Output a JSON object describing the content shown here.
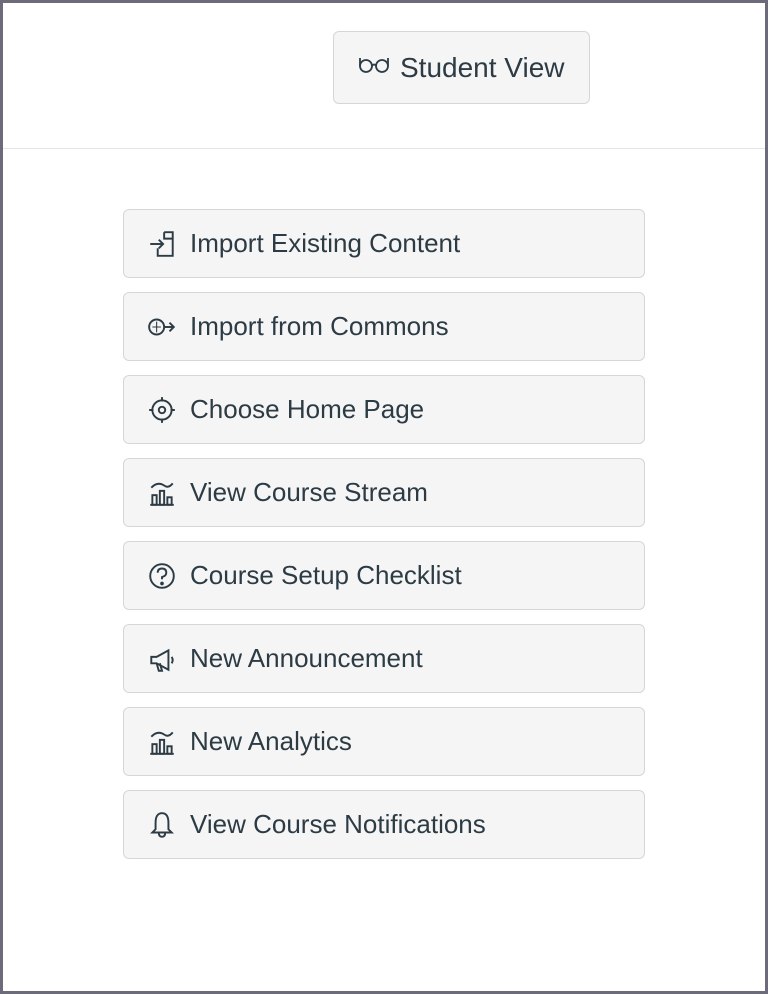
{
  "top": {
    "student_view_label": "Student View"
  },
  "actions": [
    {
      "label": "Import Existing Content"
    },
    {
      "label": "Import from Commons"
    },
    {
      "label": "Choose Home Page"
    },
    {
      "label": "View Course Stream"
    },
    {
      "label": "Course Setup Checklist"
    },
    {
      "label": "New Announcement"
    },
    {
      "label": "New Analytics"
    },
    {
      "label": "View Course Notifications"
    }
  ]
}
